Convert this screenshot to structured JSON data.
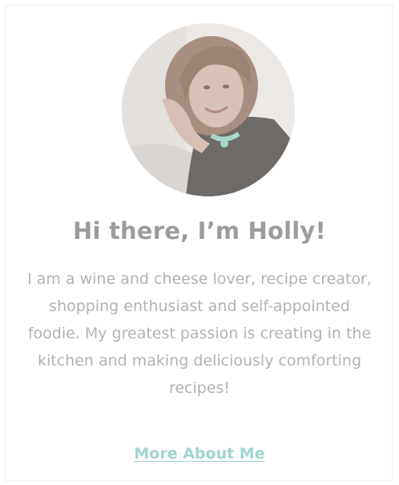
{
  "about": {
    "avatar_alt": "Holly portrait",
    "title": "Hi there, I’m Holly!",
    "bio": "I am a wine and cheese lover, recipe creator, shopping enthusiast and self-appointed foodie. My greatest passion is creating in the kitchen and making deliciously comforting recipes!",
    "link_label": "More About Me"
  },
  "colors": {
    "title": "#9c9c9c",
    "text": "#b2b2b2",
    "link": "#9fd5cf",
    "border": "#ededed"
  }
}
